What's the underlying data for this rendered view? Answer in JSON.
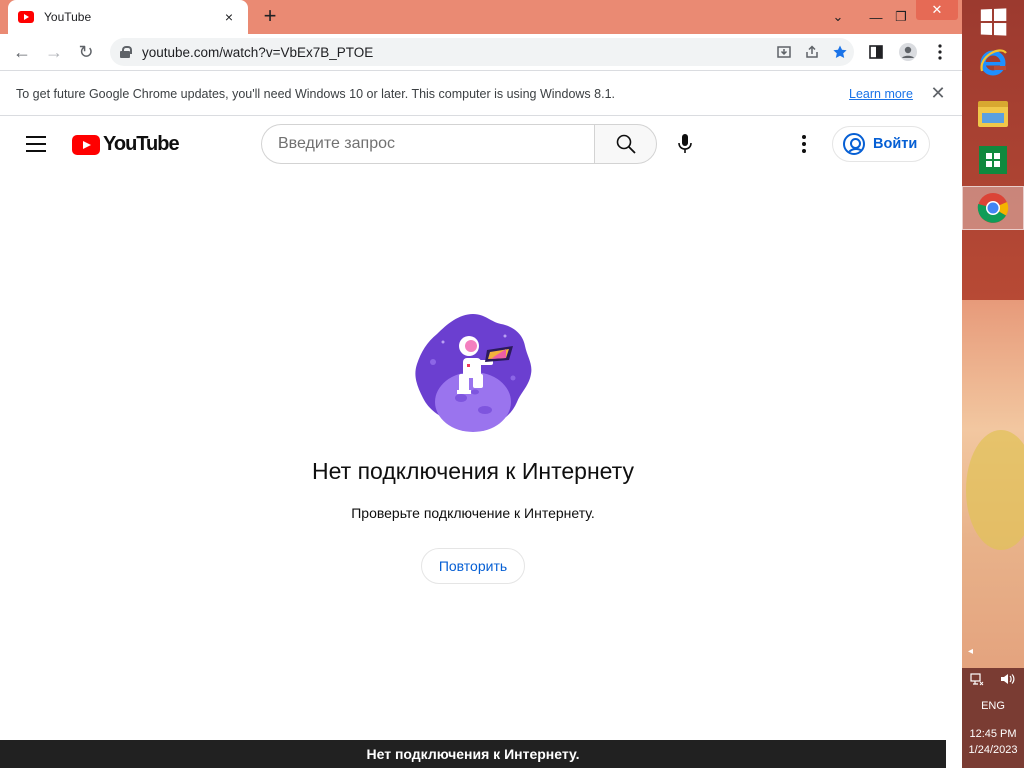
{
  "browser": {
    "tab": {
      "title": "YouTube",
      "close_glyph": "×"
    },
    "new_tab_glyph": "+",
    "window_controls": {
      "chevron": "⌄",
      "minimize": "—",
      "maximize": "❐",
      "close": "✕"
    },
    "toolbar": {
      "back": "←",
      "forward": "→",
      "reload": "↻"
    },
    "address": {
      "url": "youtube.com/watch?v=VbEx7B_PTOE"
    },
    "infobar": {
      "message": "To get future Google Chrome updates, you'll need Windows 10 or later. This computer is using Windows 8.1.",
      "link": "Learn more",
      "close_glyph": "✕"
    }
  },
  "youtube": {
    "logo_text": "YouTube",
    "search": {
      "placeholder": "Введите запрос",
      "value": ""
    },
    "sign_in": "Войти",
    "offline": {
      "title": "Нет подключения к Интернету",
      "subtitle": "Проверьте подключение к Интернету.",
      "retry": "Повторить"
    },
    "toast": "Нет подключения к Интернету."
  },
  "taskbar": {
    "tray": {
      "language": "ENG",
      "time": "12:45 PM",
      "date": "1/24/2023",
      "overflow_arrow": "◂"
    }
  },
  "colors": {
    "tabstrip": "#ea8a73",
    "youtube_red": "#ff0000",
    "link_blue": "#065fd4",
    "illustration_purple": "#6b3fd0"
  }
}
